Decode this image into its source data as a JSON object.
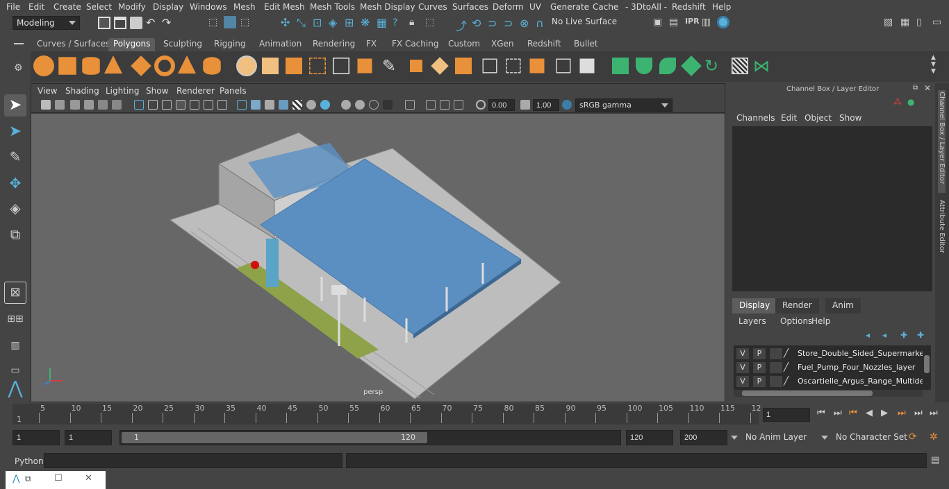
{
  "menubar": {
    "items": [
      "File",
      "Edit",
      "Create",
      "Select",
      "Modify",
      "Display",
      "Windows",
      "Mesh",
      "Edit Mesh",
      "Mesh Tools",
      "Mesh Display",
      "Curves",
      "Surfaces",
      "Deform",
      "UV",
      "Generate",
      "Cache",
      "- 3DtoAll -",
      "Redshift",
      "Help"
    ]
  },
  "statusline": {
    "mode": "Modeling",
    "live_surface": "No Live Surface"
  },
  "shelf": {
    "tabs": [
      "Curves / Surfaces",
      "Polygons",
      "Sculpting",
      "Rigging",
      "Animation",
      "Rendering",
      "FX",
      "FX Caching",
      "Custom",
      "XGen",
      "Redshift",
      "Bullet"
    ],
    "active_tab": "Polygons"
  },
  "panel": {
    "menus": [
      "View",
      "Shading",
      "Lighting",
      "Show",
      "Renderer",
      "Panels"
    ],
    "exposure": "0.00",
    "gamma": "1.00",
    "colorspace": "sRGB gamma",
    "camera": "persp"
  },
  "channelbox": {
    "title": "Channel Box / Layer Editor",
    "menus": [
      "Channels",
      "Edit",
      "Object",
      "Show"
    ]
  },
  "layereditor": {
    "tabs": [
      "Display",
      "Render",
      "Anim"
    ],
    "active_tab": "Display",
    "menus": [
      "Layers",
      "Options",
      "Help"
    ],
    "layers": [
      {
        "v": "V",
        "p": "P",
        "name": "Store_Double_Sided_Supermarket_"
      },
      {
        "v": "V",
        "p": "P",
        "name": "Fuel_Pump_Four_Nozzles_layer"
      },
      {
        "v": "V",
        "p": "P",
        "name": "Oscartielle_Argus_Range_Multidec"
      }
    ]
  },
  "sidetabs": {
    "channel": "Channel Box / Layer Editor",
    "attribute": "Attribute Editor"
  },
  "timeslider": {
    "ticks": [
      "5",
      "10",
      "15",
      "20",
      "25",
      "30",
      "35",
      "40",
      "45",
      "50",
      "55",
      "60",
      "65",
      "70",
      "75",
      "80",
      "85",
      "90",
      "95",
      "100",
      "105",
      "110",
      "115",
      "12"
    ],
    "start_marker": "1",
    "current_frame": "1"
  },
  "range": {
    "start": "1",
    "inner_start": "1",
    "slider_start": "1",
    "slider_end": "120",
    "end": "120",
    "max_end": "200",
    "anim_layer": "No Anim Layer",
    "char_set": "No Character Set"
  },
  "cmdline": {
    "label": "Python"
  },
  "colors": {
    "accent_blue": "#5285a6",
    "canopy_blue": "#5b8fc2"
  }
}
